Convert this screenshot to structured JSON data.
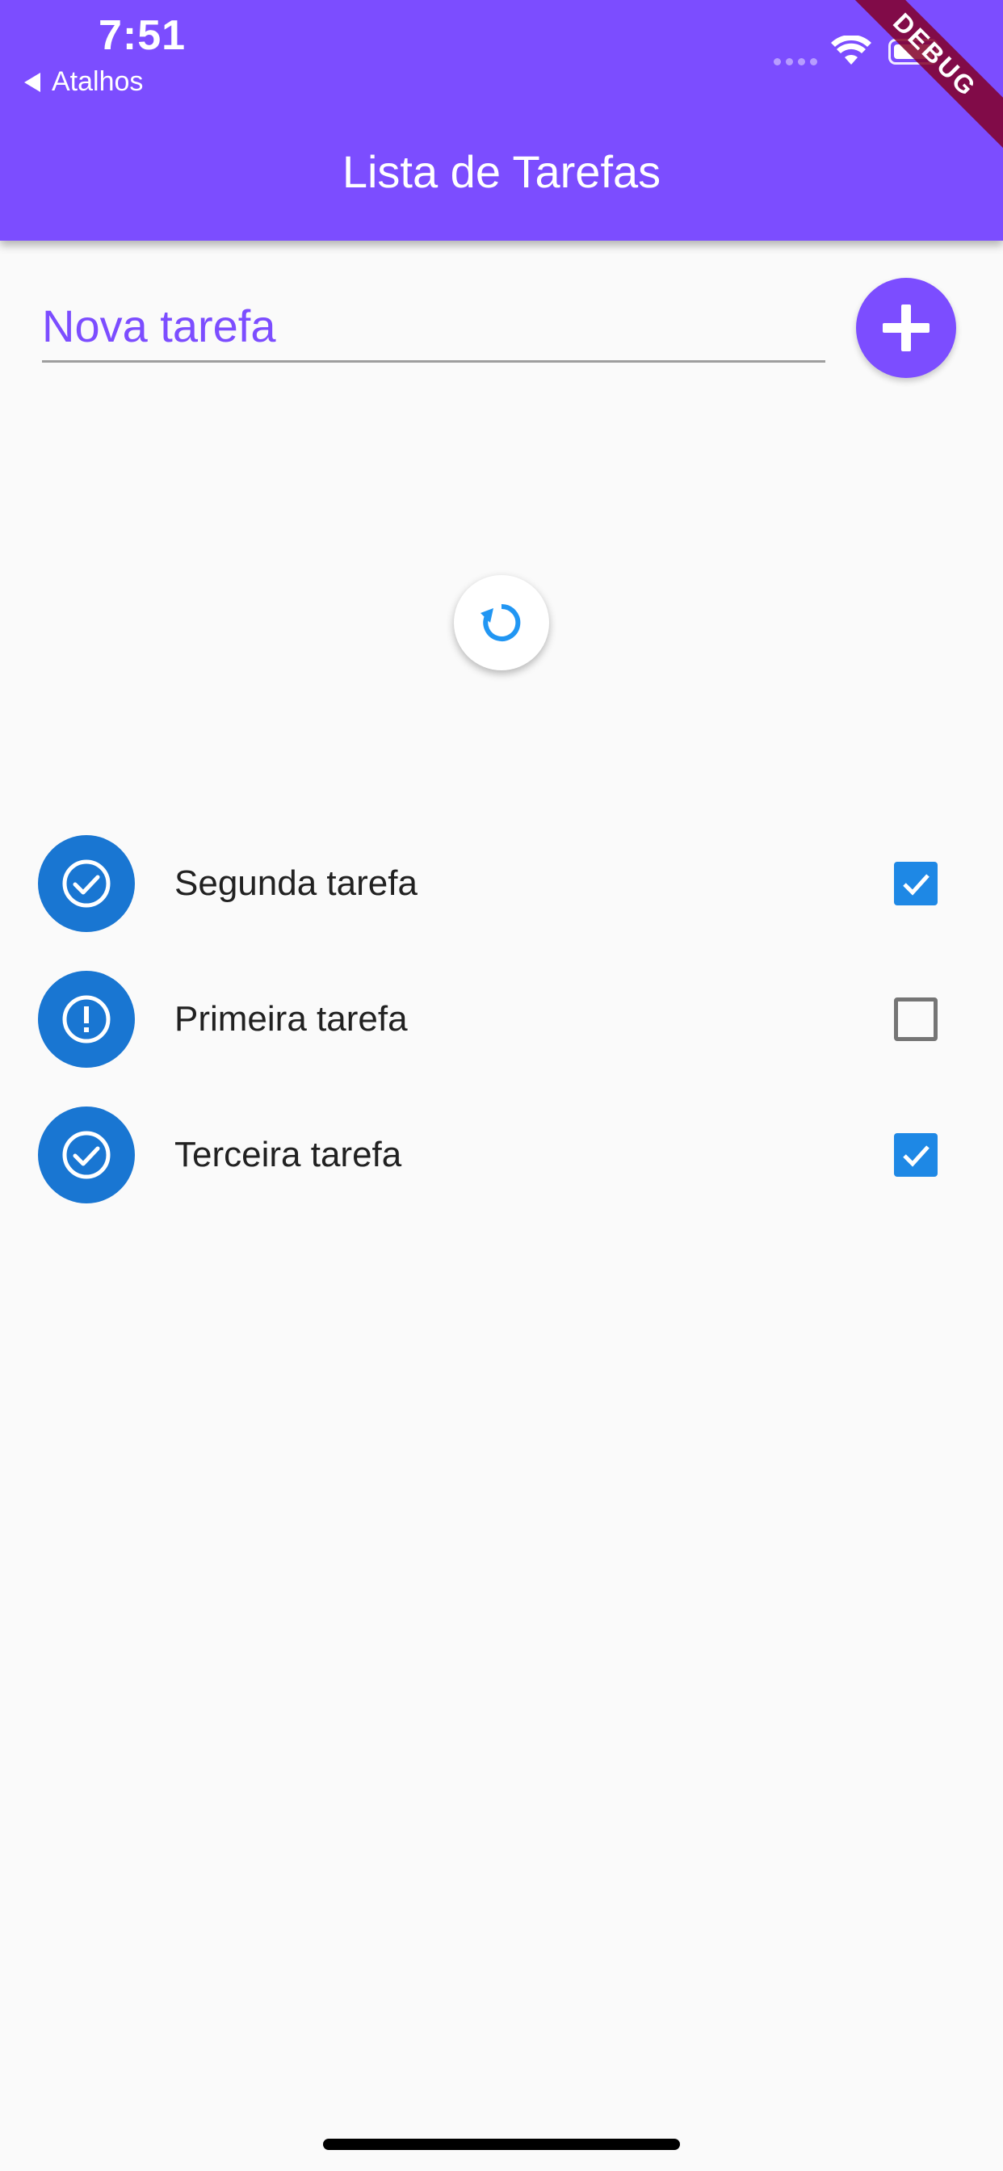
{
  "status_bar": {
    "time": "7:51",
    "back_app": "Atalhos"
  },
  "app_bar": {
    "title": "Lista de Tarefas",
    "color": "#7c4dff",
    "debug_banner": "DEBUG"
  },
  "new_task": {
    "placeholder": "Nova tarefa",
    "value": ""
  },
  "add_button": {
    "icon": "plus-icon"
  },
  "refresh": {
    "icon": "refresh-icon"
  },
  "tasks": [
    {
      "title": "Segunda tarefa",
      "done": true,
      "status_icon": "check-circle-icon"
    },
    {
      "title": "Primeira tarefa",
      "done": false,
      "status_icon": "error-icon"
    },
    {
      "title": "Terceira tarefa",
      "done": true,
      "status_icon": "check-circle-icon"
    }
  ],
  "colors": {
    "accent": "#7c4dff",
    "status_avatar": "#1976d2",
    "checkbox_checked": "#1e88e5"
  }
}
